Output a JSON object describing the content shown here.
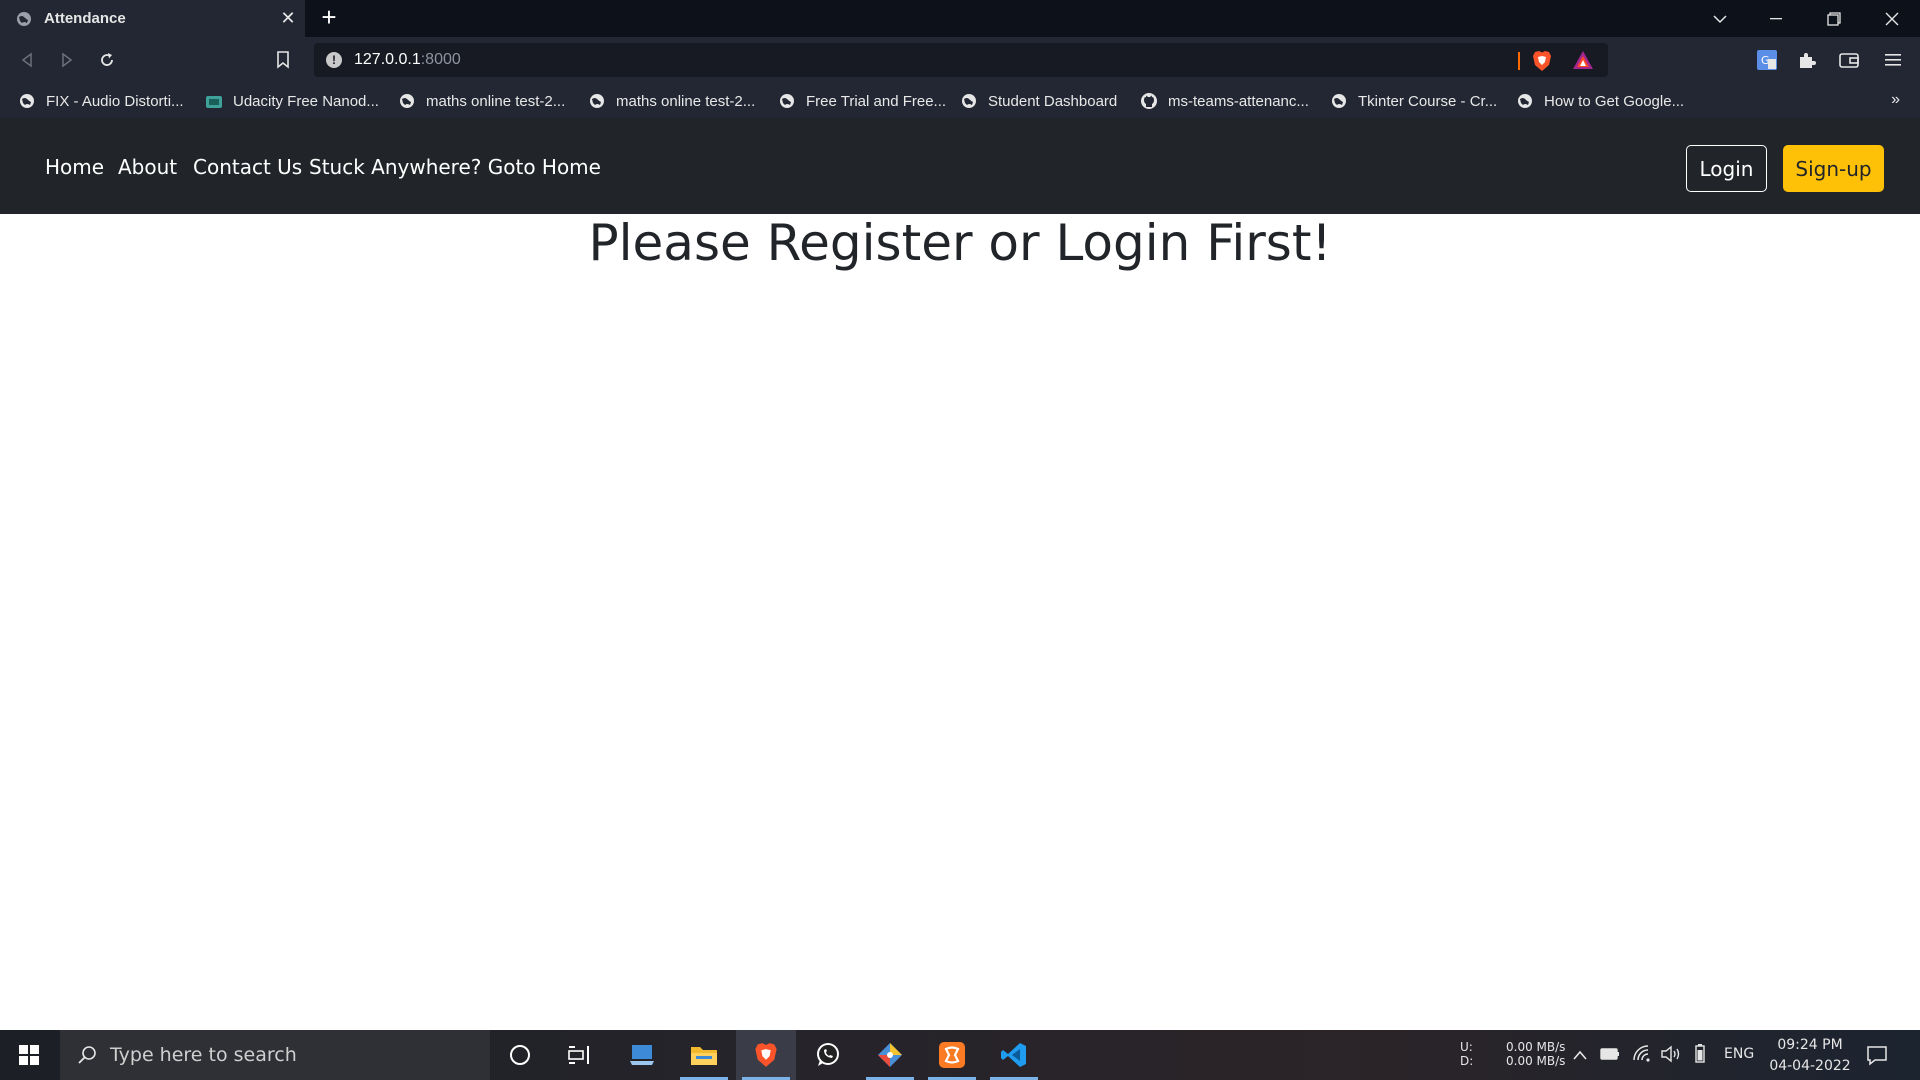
{
  "browser": {
    "tab_title": "Attendance",
    "tab_close": "✕",
    "new_tab": "+",
    "url_host": "127.0.0.1",
    "url_port": ":8000",
    "bookmarks": [
      {
        "label": "FIX - Audio Distorti...",
        "icon": "globe-icon"
      },
      {
        "label": "Udacity Free Nanod...",
        "icon": "udacity-icon"
      },
      {
        "label": "maths online test-2...",
        "icon": "globe-icon"
      },
      {
        "label": "maths online test-2...",
        "icon": "globe-icon"
      },
      {
        "label": "Free Trial and Free...",
        "icon": "globe-icon"
      },
      {
        "label": "Student Dashboard",
        "icon": "globe-icon"
      },
      {
        "label": "ms-teams-attenanc...",
        "icon": "github-icon"
      },
      {
        "label": "Tkinter Course - Cr...",
        "icon": "globe-icon"
      },
      {
        "label": "How to Get Google...",
        "icon": "globe-icon"
      }
    ],
    "bookmarks_more": "»"
  },
  "navbar": {
    "links": [
      "Home",
      "About",
      "Contact Us",
      "Stuck Anywhere? Goto Home"
    ],
    "login_label": "Login",
    "signup_label": "Sign-up"
  },
  "main": {
    "heading": "Please Register or Login First!"
  },
  "taskbar": {
    "search_placeholder": "Type here to search",
    "net_up_label": "U:",
    "net_down_label": "D:",
    "net_up_value": "0.00 MB/s",
    "net_down_value": "0.00 MB/s",
    "language": "ENG",
    "time": "09:24 PM",
    "date": "04-04-2022"
  },
  "colors": {
    "navbar_bg": "#212529",
    "signup_bg": "#ffc107",
    "browser_chrome": "#232733"
  }
}
